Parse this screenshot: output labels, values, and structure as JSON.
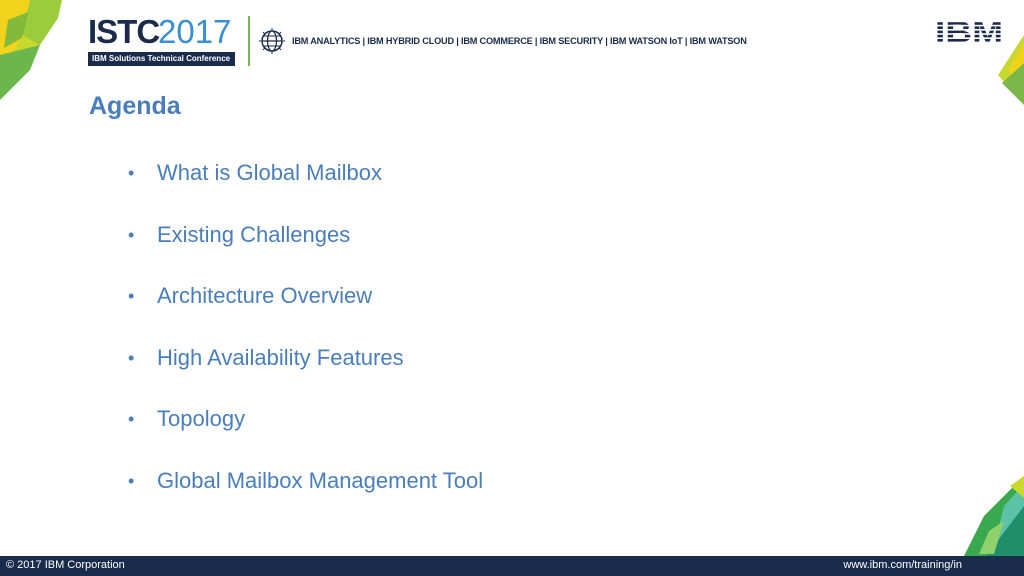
{
  "header": {
    "logo_word": "ISTC",
    "logo_year": "2017",
    "conference_label": "IBM Solutions Technical Conference",
    "brand_nav": "IBM ANALYTICS | IBM HYBRID CLOUD | IBM COMMERCE | IBM SECURITY | IBM WATSON IoT | IBM WATSON",
    "corner_logo": "IBM"
  },
  "slide": {
    "title": "Agenda",
    "items": [
      "What is Global Mailbox",
      "Existing Challenges",
      "Architecture Overview",
      "High Availability Features",
      "Topology",
      "Global Mailbox Management Tool"
    ]
  },
  "footer": {
    "copyright": "© 2017 IBM Corporation",
    "url": "www.ibm.com/training/in"
  },
  "colors": {
    "navy": "#1a2b4c",
    "accent_blue": "#4a7ebb",
    "year_blue": "#3a8fd0",
    "green": "#7ab648",
    "yellow": "#f2d31b"
  },
  "icons": [
    "globe-icon",
    "ibm-logo-icon",
    "corner-decoration-icon"
  ]
}
